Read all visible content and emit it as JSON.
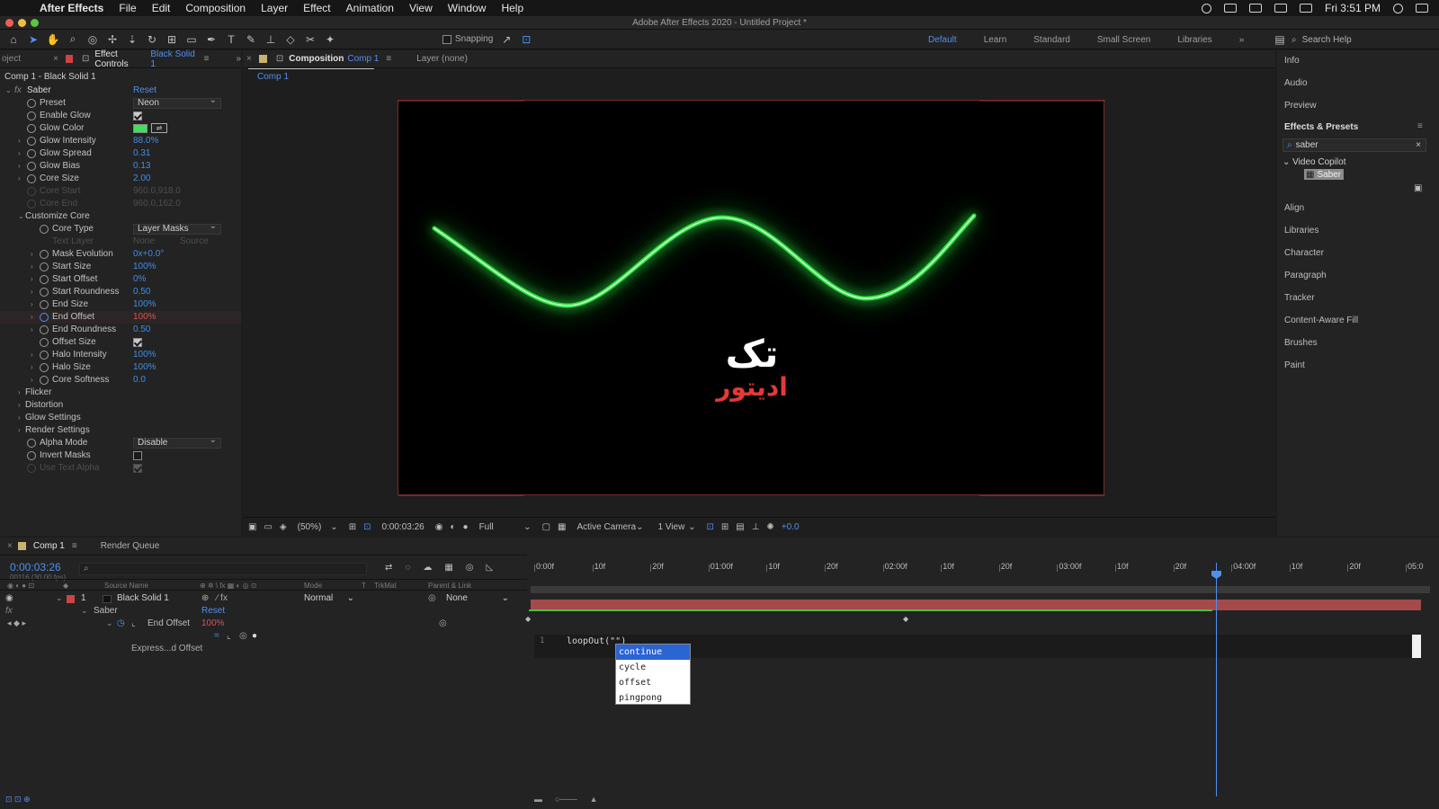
{
  "menubar": {
    "app": "After Effects",
    "items": [
      "File",
      "Edit",
      "Composition",
      "Layer",
      "Effect",
      "Animation",
      "View",
      "Window",
      "Help"
    ],
    "clock": "Fri 3:51 PM"
  },
  "titlebar": {
    "title": "Adobe After Effects 2020 - Untitled Project *"
  },
  "toolbar": {
    "snapping": "Snapping",
    "workspaces": [
      "Default",
      "Learn",
      "Standard",
      "Small Screen",
      "Libraries"
    ],
    "search_placeholder": "Search Help"
  },
  "effect_panel": {
    "tab_project": "oject",
    "tab_label": "Effect Controls",
    "tab_layer": "Black Solid 1",
    "subtitle": "Comp 1 - Black Solid 1",
    "effect_name": "Saber",
    "reset": "Reset",
    "props": [
      {
        "name": "Preset",
        "value": "Neon",
        "type": "dropdown"
      },
      {
        "name": "Enable Glow",
        "value": "",
        "type": "check"
      },
      {
        "name": "Glow Color",
        "value": "",
        "type": "color"
      },
      {
        "name": "Glow Intensity",
        "value": "88.0%"
      },
      {
        "name": "Glow Spread",
        "value": "0.31"
      },
      {
        "name": "Glow Bias",
        "value": "0.13"
      },
      {
        "name": "Core Size",
        "value": "2.00"
      },
      {
        "name": "Core Start",
        "value": "960.0,918.0",
        "dim": true
      },
      {
        "name": "Core End",
        "value": "960.0,162.0",
        "dim": true
      },
      {
        "name": "Customize Core",
        "value": "",
        "group": true
      },
      {
        "name": "Core Type",
        "value": "Layer Masks",
        "type": "dropdown"
      },
      {
        "name": "Text Layer",
        "value": "None",
        "dim": true,
        "value2": "Source"
      },
      {
        "name": "Mask Evolution",
        "value": "0x+0.0°"
      },
      {
        "name": "Start Size",
        "value": "100%"
      },
      {
        "name": "Start Offset",
        "value": "0%"
      },
      {
        "name": "Start Roundness",
        "value": "0.50"
      },
      {
        "name": "End Size",
        "value": "100%"
      },
      {
        "name": "End Offset",
        "value": "100%",
        "red": true
      },
      {
        "name": "End Roundness",
        "value": "0.50"
      },
      {
        "name": "Offset Size",
        "value": "",
        "type": "check"
      },
      {
        "name": "Halo Intensity",
        "value": "100%"
      },
      {
        "name": "Halo Size",
        "value": "100%"
      },
      {
        "name": "Core Softness",
        "value": "0.0"
      },
      {
        "name": "Flicker",
        "value": "",
        "group": true
      },
      {
        "name": "Distortion",
        "value": "",
        "group": true
      },
      {
        "name": "Glow Settings",
        "value": "",
        "group": true
      },
      {
        "name": "Render Settings",
        "value": "",
        "group": true
      },
      {
        "name": "Alpha Mode",
        "value": "Disable",
        "type": "dropdown"
      },
      {
        "name": "Invert Masks",
        "value": "",
        "type": "check_off"
      },
      {
        "name": "Use Text Alpha",
        "value": "",
        "type": "check_dim",
        "dim": true
      }
    ]
  },
  "comp_panel": {
    "tab_label": "Composition",
    "tab_comp": "Comp 1",
    "layer_tab": "Layer (none)",
    "sub_tab": "Comp 1",
    "watermark_top": "تک",
    "watermark_bottom": "ادیتور",
    "zoom": "(50%)",
    "timecode": "0:00:03:26",
    "resolution": "Full",
    "camera": "Active Camera",
    "views": "1 View",
    "exposure": "+0.0"
  },
  "right_panel": {
    "items_top": [
      "Info",
      "Audio",
      "Preview"
    ],
    "effects_title": "Effects & Presets",
    "search_value": "saber",
    "category": "Video Copilot",
    "result": "Saber",
    "items_bottom": [
      "Align",
      "Libraries",
      "Character",
      "Paragraph",
      "Tracker",
      "Content-Aware Fill",
      "Brushes",
      "Paint"
    ]
  },
  "timeline": {
    "tab_comp": "Comp 1",
    "tab_render": "Render Queue",
    "timecode": "0:00:03:26",
    "fps": "00116 (30.00 fps)",
    "col_source": "Source Name",
    "col_mode": "Mode",
    "col_t": "T",
    "col_trkmat": "TrkMat",
    "col_parent": "Parent & Link",
    "layer_num": "1",
    "layer_name": "Black Solid 1",
    "layer_mode": "Normal",
    "layer_parent": "None",
    "effect_row": "Saber",
    "effect_reset": "Reset",
    "prop_name": "End Offset",
    "prop_value": "100%",
    "expr_label": "Express...d Offset",
    "ruler_labels": [
      "0:00f",
      "10f",
      "20f",
      "01:00f",
      "10f",
      "20f",
      "02:00f",
      "10f",
      "20f",
      "03:00f",
      "10f",
      "20f",
      "04:00f",
      "10f",
      "20f",
      "05:0"
    ],
    "expr_line": "1",
    "expr_text": "loopOut(\"\")",
    "autocomplete": [
      "continue",
      "cycle",
      "offset",
      "pingpong"
    ]
  },
  "colors": {
    "accent": "#4f8ff0",
    "layer_bar": "#a44a4a",
    "glow": "#57ff6a",
    "watermark_red": "#e53935"
  }
}
